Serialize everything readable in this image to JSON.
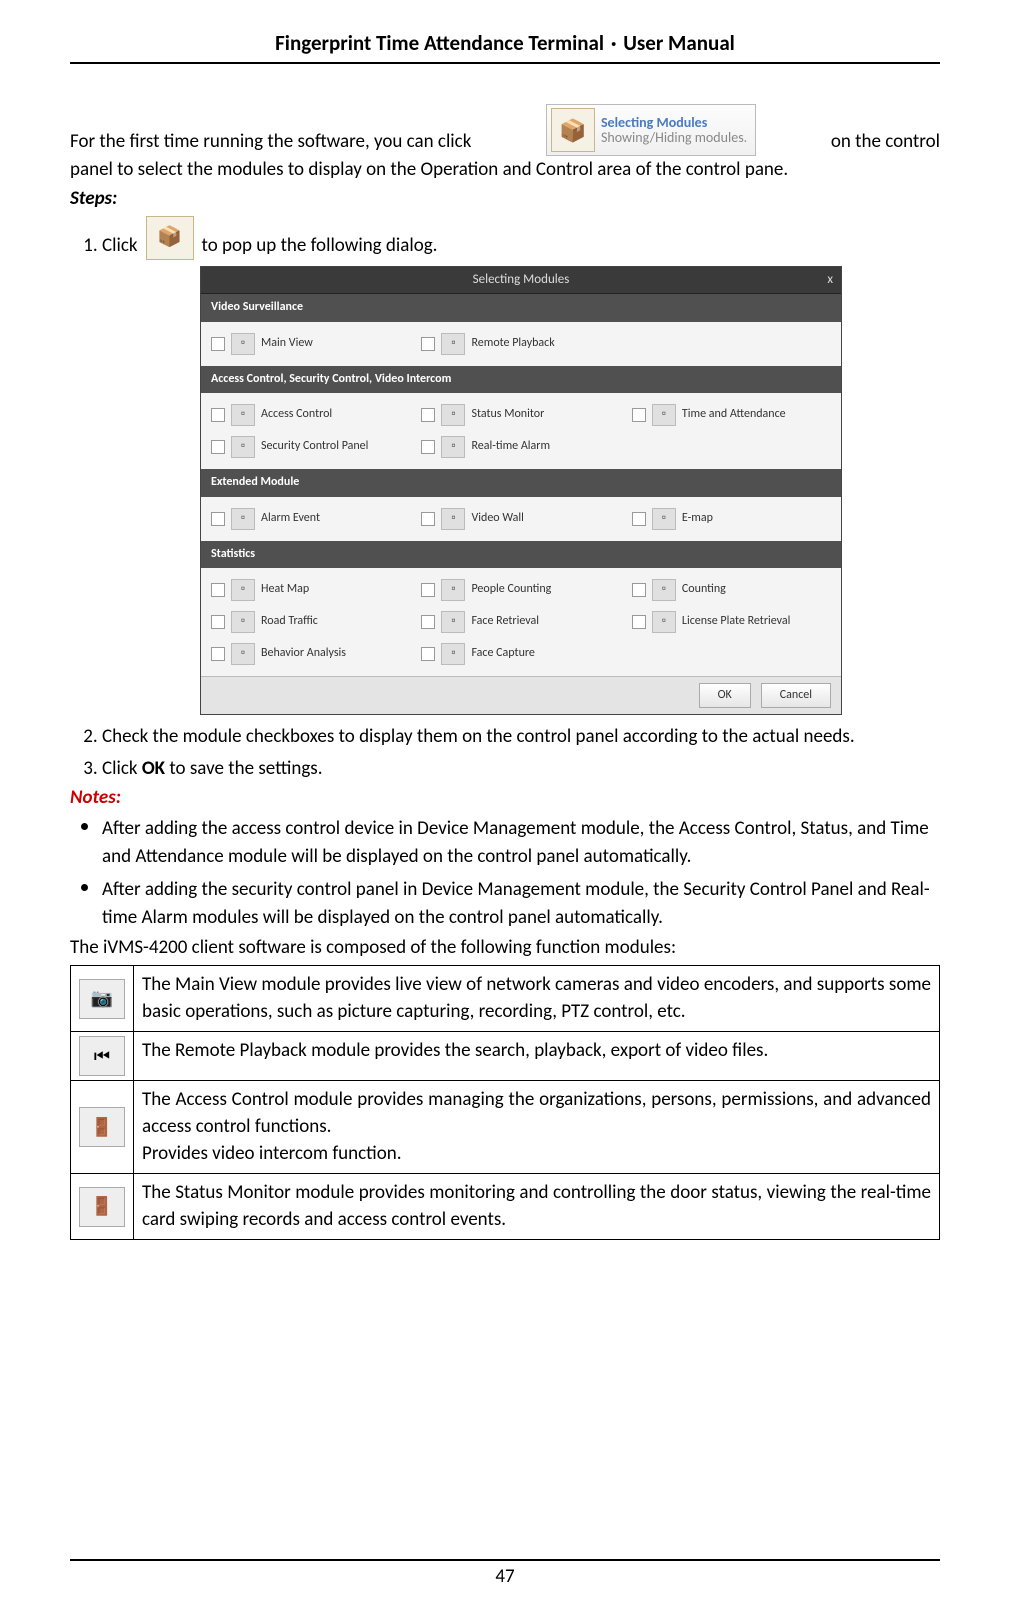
{
  "header": {
    "title_a": "Fingerprint Time Attendance Terminal",
    "sep": "·",
    "title_b": "User Manual"
  },
  "intro": {
    "l1a": "For the first time running the software, you can click",
    "tt_a": "Selecting Modules",
    "tt_b": "Showing/Hiding modules.",
    "box_glyph": "📦",
    "l1b": "on the control",
    "l2": "panel to select the modules to display on the Operation and Control area of the control pane."
  },
  "steps_h": "Steps:",
  "steps": {
    "s1a": "Click",
    "s1_glyph": "📦",
    "s1b": "to pop up the following dialog.",
    "s2": "Check the module checkboxes to display them on the control panel according to the actual needs.",
    "s3a": "Click ",
    "s3b": "OK",
    "s3c": " to save the settings."
  },
  "dlg": {
    "title": "Selecting Modules",
    "close": "x",
    "sec1": "Video Surveillance",
    "sec1_items": [
      "Main View",
      "Remote Playback"
    ],
    "sec2": "Access Control, Security Control, Video Intercom",
    "sec2_items": [
      "Access Control",
      "Status Monitor",
      "Time and Attendance",
      "Security Control Panel",
      "Real-time Alarm"
    ],
    "sec3": "Extended Module",
    "sec3_items": [
      "Alarm Event",
      "Video Wall",
      "E-map"
    ],
    "sec4": "Statistics",
    "sec4_items": [
      "Heat Map",
      "People Counting",
      "Counting",
      "Road Traffic",
      "Face Retrieval",
      "License Plate Retrieval",
      "Behavior Analysis",
      "Face Capture"
    ],
    "ok": "OK",
    "cancel": "Cancel"
  },
  "notes_h": "Notes:",
  "notes": {
    "n1": "After adding the access control device in Device Management module, the Access Control, Status, and Time and Attendance module will be displayed on the control panel automatically.",
    "n2": "After adding the security control panel in Device Management module, the Security Control Panel and Real-time Alarm modules will be displayed on the control panel automatically."
  },
  "after": "The iVMS-4200 client software is composed of the following function modules:",
  "mods": {
    "r1": {
      "g": "📷",
      "t": "The Main View module provides live view of network cameras and video encoders, and supports some basic operations, such as picture capturing, recording, PTZ control, etc."
    },
    "r2": {
      "g": "⏮",
      "t": "The Remote Playback module provides the search, playback, export of video files."
    },
    "r3": {
      "g": "🚪",
      "t": "The Access Control module provides managing the organizations, persons, permissions, and advanced access control functions.\nProvides video intercom function."
    },
    "r4": {
      "g": "🚪",
      "t": "The Status Monitor module provides monitoring and controlling the door status, viewing the real-time card swiping records and access control events."
    }
  },
  "page": "47"
}
